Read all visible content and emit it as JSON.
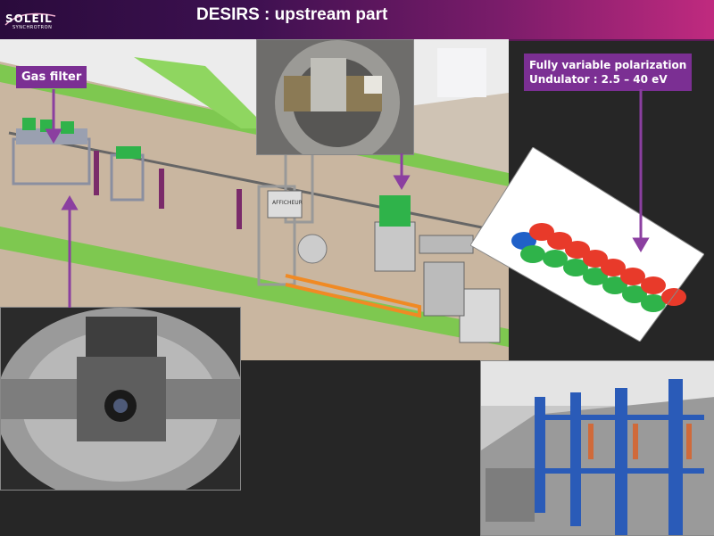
{
  "header": {
    "title": "DESIRS : upstream part"
  },
  "logo": {
    "word": "SOLEIL",
    "sub": "SYNCHROTRON"
  },
  "labels": {
    "gas_filter": "Gas filter",
    "polarization_line1": "Fully variable polarization",
    "polarization_line2": "Undulator : 2.5 – 40 eV"
  },
  "cad": {
    "display_tag": "AFFICHEUR"
  },
  "colors": {
    "accent": "#7b2f93",
    "header_dark": "#2a0b3c",
    "header_light": "#c02a7f",
    "cad_floor": "#c9b6a0",
    "cad_rail": "#7ec850",
    "background": "#262626"
  }
}
